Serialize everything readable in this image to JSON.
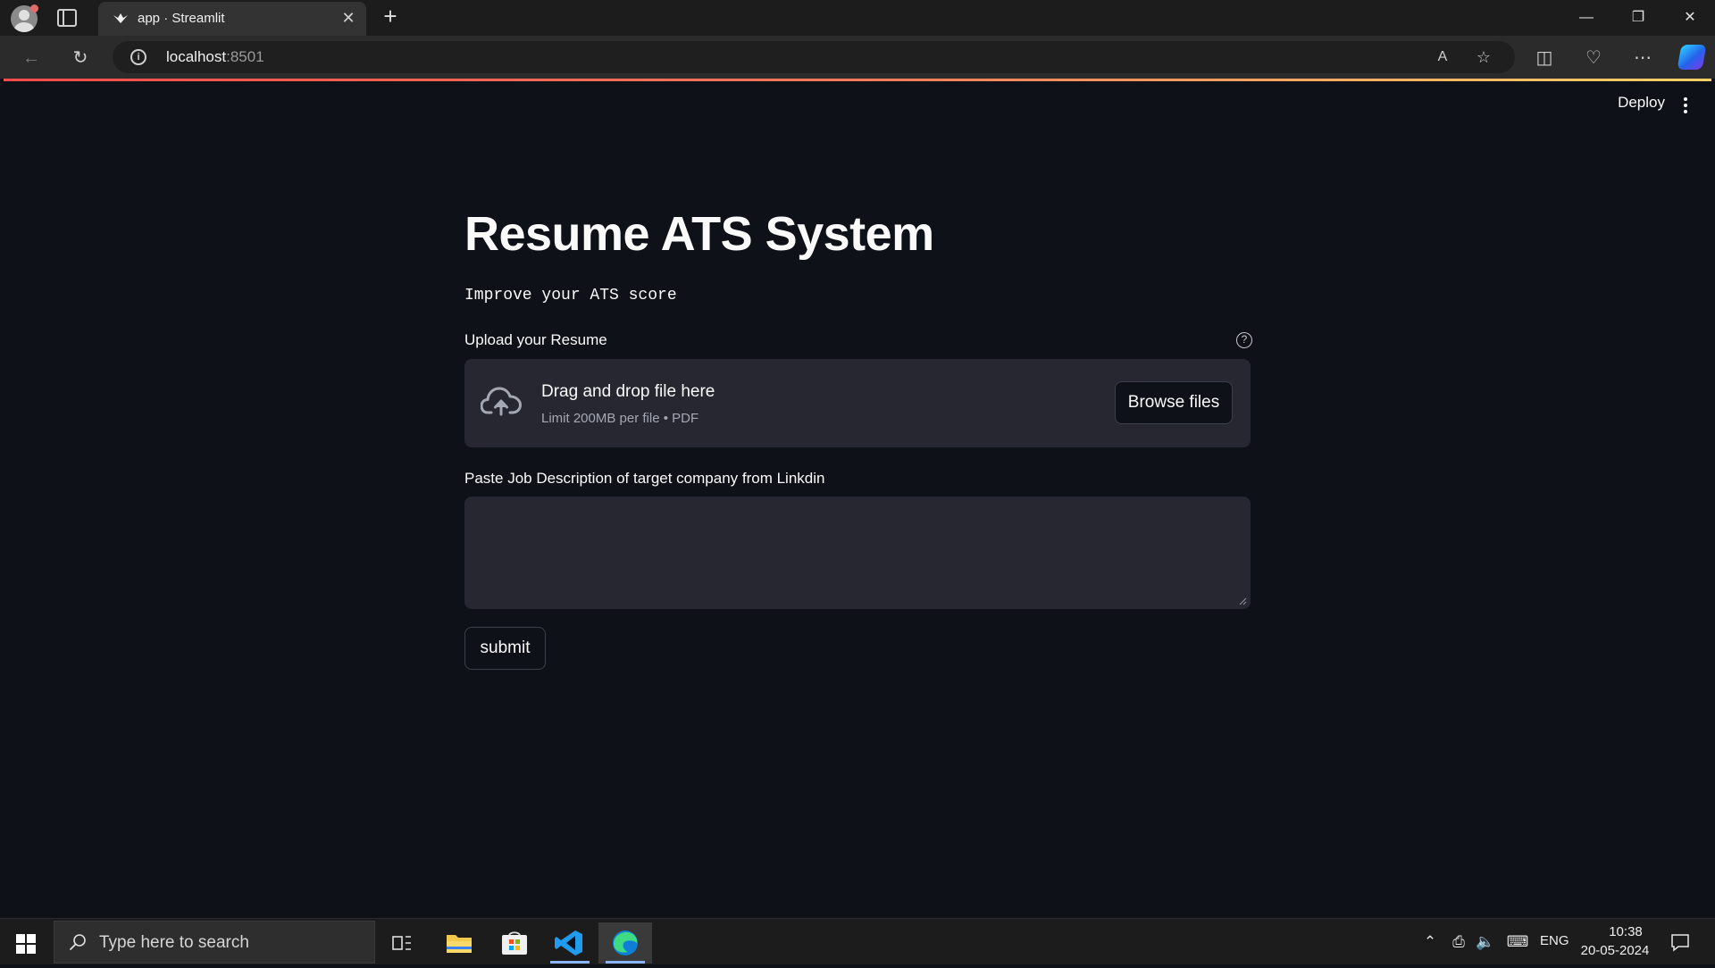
{
  "browser": {
    "tab_title": "app · Streamlit",
    "address_host": "localhost",
    "address_port": ":8501",
    "new_tab_symbol": "+",
    "tab_close_symbol": "✕"
  },
  "app": {
    "deploy_label": "Deploy",
    "title": "Resume ATS System",
    "subtitle": "Improve your ATS score",
    "upload": {
      "label": "Upload your Resume",
      "dropzone_title": "Drag and drop file here",
      "dropzone_limit": "Limit 200MB per file • PDF",
      "browse_label": "Browse files"
    },
    "job_description": {
      "label": "Paste Job Description of target company from Linkdin",
      "value": ""
    },
    "submit_label": "submit"
  },
  "taskbar": {
    "search_placeholder": "Type here to search",
    "language": "ENG",
    "time": "10:38",
    "date": "20-05-2024"
  },
  "colors": {
    "app_background": "#0e1117",
    "widget_background": "#262730",
    "text": "#fafafa",
    "muted_text": "#a3a8b4",
    "accent_bar_start": "#ff4b4b",
    "accent_bar_end": "#ffd166"
  }
}
